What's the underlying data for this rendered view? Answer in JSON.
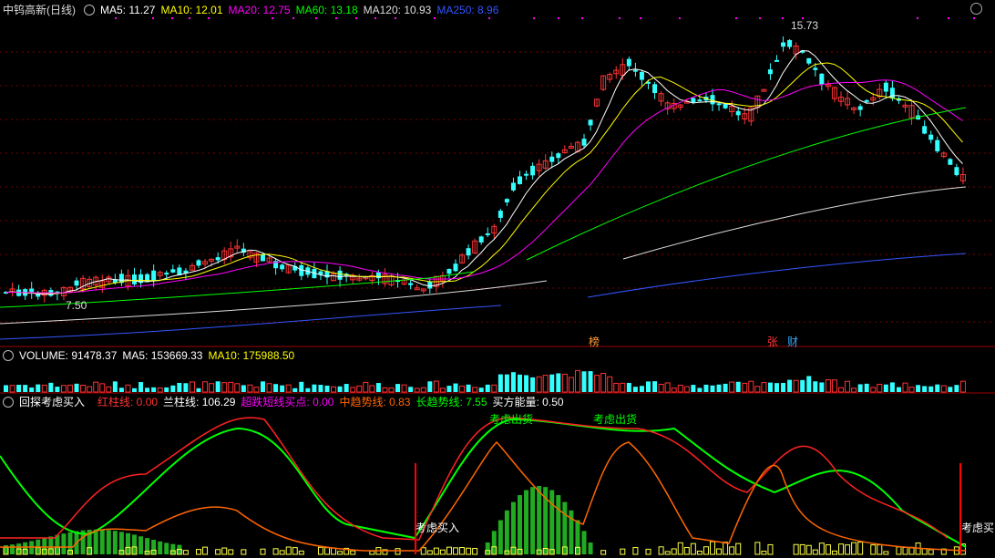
{
  "main": {
    "title": "中钨高新(日线)",
    "ma": [
      {
        "label": "MA5: 11.27",
        "color": "#ffffff"
      },
      {
        "label": "MA10: 12.01",
        "color": "#ffff00"
      },
      {
        "label": "MA20: 12.75",
        "color": "#ff00ff"
      },
      {
        "label": "MA60: 13.18",
        "color": "#00ff00"
      },
      {
        "label": "MA120: 10.93",
        "color": "#dddddd"
      },
      {
        "label": "MA250: 8.96",
        "color": "#3355ff"
      }
    ],
    "high_label": "15.73",
    "low_label": "7.50",
    "event_tags": [
      {
        "text": "榜",
        "color": "#ff9933"
      },
      {
        "text": "张",
        "color": "#ff3333"
      },
      {
        "text": "财",
        "color": "#33aaff"
      }
    ]
  },
  "volume": {
    "label": "VOLUME: 91478.37",
    "ma5": "MA5: 153669.33",
    "ma10": "MA10: 175988.50"
  },
  "indicator": {
    "name": "回探考虑买入",
    "items": [
      {
        "label": "红柱线: 0.00",
        "color": "#ff3333"
      },
      {
        "label": "兰柱线: 106.29",
        "color": "#ffffff"
      },
      {
        "label": "超跌短线买点: 0.00",
        "color": "#ff00ff"
      },
      {
        "label": "中趋势线: 0.83",
        "color": "#ff6600"
      },
      {
        "label": "长趋势线: 7.55",
        "color": "#00ff00"
      },
      {
        "label": "买方能量: 0.50",
        "color": "#ffffff"
      }
    ],
    "signals": [
      "考虑出货",
      "考虑出货",
      "考虑买入",
      "考虑买"
    ]
  },
  "colors": {
    "up": "#ff3333",
    "down": "#33ffff",
    "grid": "#7a0000"
  }
}
